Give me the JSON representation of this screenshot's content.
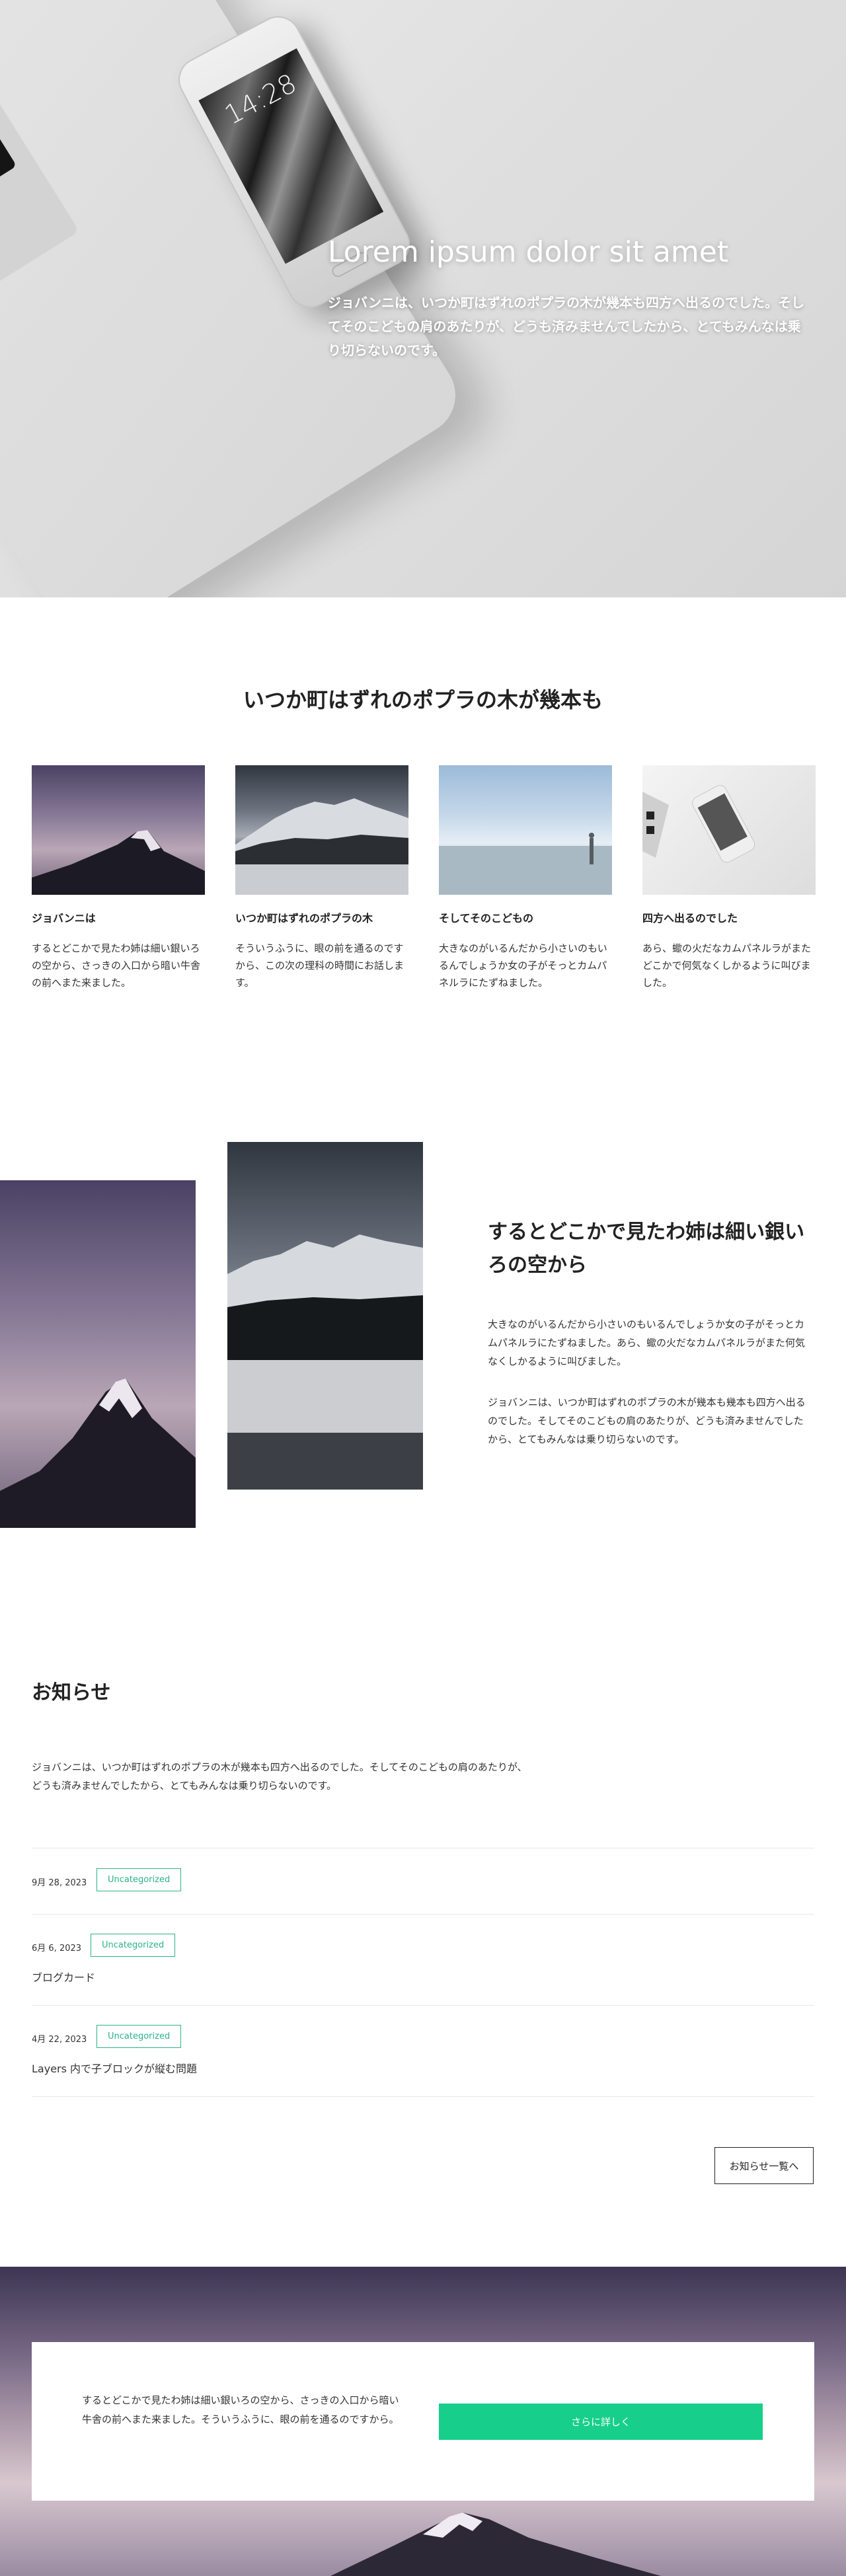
{
  "hero": {
    "title": "Lorem ipsum dolor sit amet",
    "text": "ジョバンニは、いつか町はずれのポプラの木が幾本も四方へ出るのでした。そしてそのこどもの肩のあたりが、どうも済みませんでしたから、とてもみんなは乗り切らないのです。",
    "phone_clock": "14:28"
  },
  "features": {
    "title": "いつか町はずれのポプラの木が幾本も",
    "cards": [
      {
        "title": "ジョバンニは",
        "text": "するとどこかで見たわ姉は細い銀いろの空から、さっきの入口から暗い牛舎の前へまた来ました。"
      },
      {
        "title": "いつか町はずれのポプラの木",
        "text": "そういうふうに、眼の前を通るのですから、この次の理科の時間にお話します。"
      },
      {
        "title": "そしてそのこどもの",
        "text": "大きなのがいるんだから小さいのもいるんでしょうか女の子がそっとカムパネルラにたずねました。"
      },
      {
        "title": "四方へ出るのでした",
        "text": "あら、蠍の火だなカムパネルラがまたどこかで何気なくしかるように叫びました。"
      }
    ]
  },
  "about": {
    "title": "するとどこかで見たわ姉は細い銀いろの空から",
    "p1": "大きなのがいるんだから小さいのもいるんでしょうか女の子がそっとカムパネルラにたずねました。あら、蠍の火だなカムパネルラがまた何気なくしかるように叫びました。",
    "p2": "ジョバンニは、いつか町はずれのポプラの木が幾本も幾本も四方へ出るのでした。そしてそのこどもの肩のあたりが、どうも済みませんでしたから、とてもみんなは乗り切らないのです。"
  },
  "news": {
    "title": "お知らせ",
    "intro": "ジョバンニは、いつか町はずれのポプラの木が幾本も四方へ出るのでした。そしてそのこどもの肩のあたりが、どうも済みませんでしたから、とてもみんなは乗り切らないのです。",
    "items": [
      {
        "date": "9月 28, 2023",
        "category": "Uncategorized",
        "title": ""
      },
      {
        "date": "6月 6, 2023",
        "category": "Uncategorized",
        "title": "ブログカード"
      },
      {
        "date": "4月 22, 2023",
        "category": "Uncategorized",
        "title": "Layers 内で子ブロックが縦む問題"
      }
    ],
    "more_label": "お知らせ一覧へ"
  },
  "cta": {
    "text": "するとどこかで見たわ姉は細い銀いろの空から、さっきの入口から暗い牛舎の前へまた来ました。そういうふうに、眼の前を通るのですから。",
    "button_label": "さらに詳しく",
    "button_color": "#17cf8a"
  },
  "colors": {
    "accent_green": "#2bb38a",
    "text": "#222222"
  }
}
